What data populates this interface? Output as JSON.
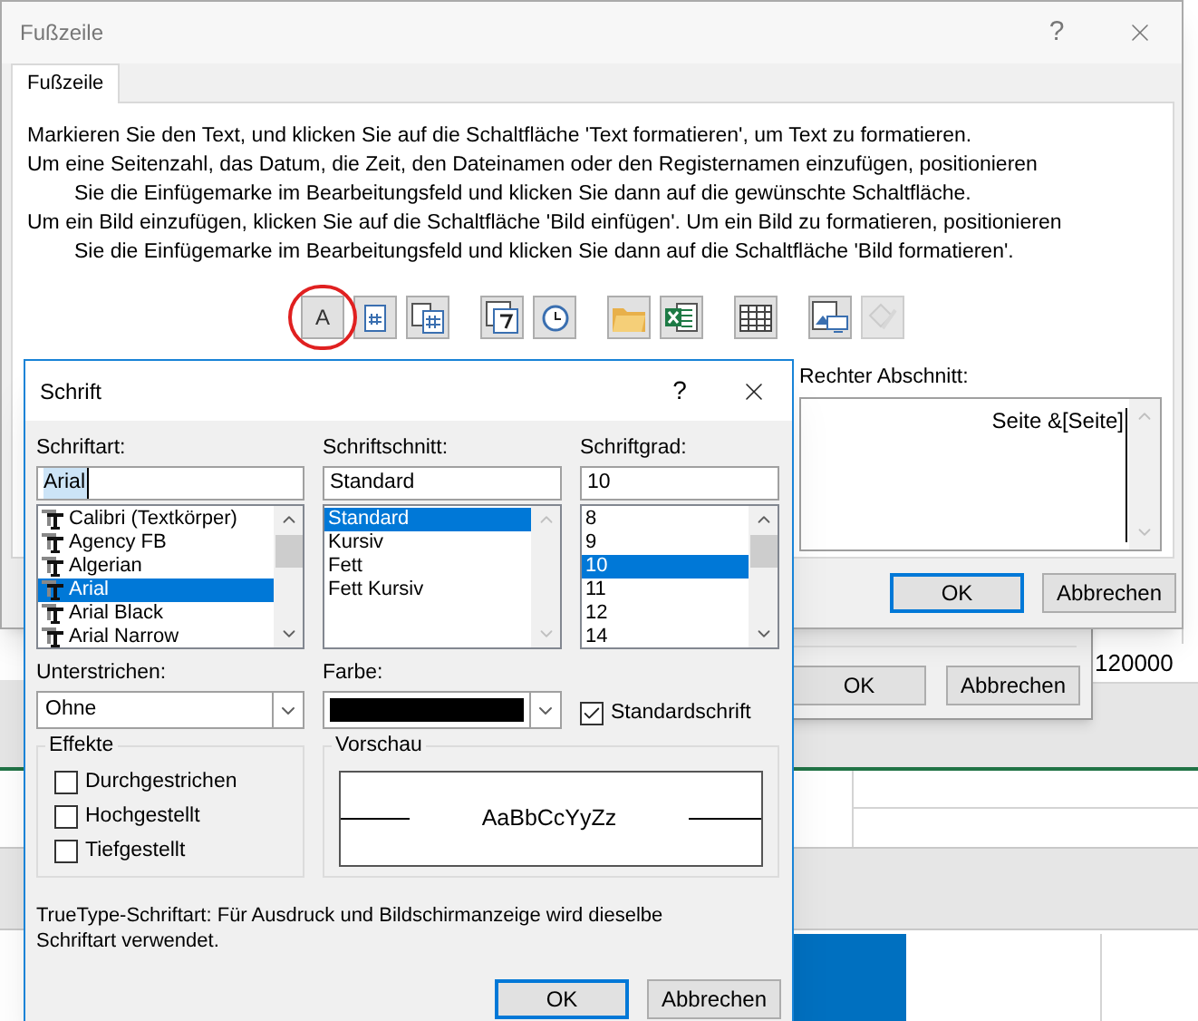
{
  "footer_dialog": {
    "title": "Fußzeile",
    "help": "?",
    "tab": {
      "label": "Fußzeile",
      "selected": true
    },
    "instructions": [
      {
        "text": "Markieren Sie den Text, und klicken Sie auf die Schaltfläche 'Text formatieren', um Text zu formatieren.",
        "indented": false
      },
      {
        "text": "Um eine Seitenzahl, das Datum, die Zeit, den Dateinamen oder den Registernamen einzufügen, positionieren",
        "indented": false
      },
      {
        "text": "Sie die Einfügemarke im Bearbeitungsfeld und klicken Sie dann auf die gewünschte Schaltfläche.",
        "indented": true
      },
      {
        "text": "Um ein Bild einzufügen, klicken Sie auf die Schaltfläche 'Bild einfügen'. Um ein Bild zu formatieren, positionieren",
        "indented": false
      },
      {
        "text": "Sie die Einfügemarke im Bearbeitungsfeld und klicken Sie dann auf die Schaltfläche 'Bild formatieren'.",
        "indented": true
      }
    ],
    "toolbar": [
      {
        "kind": "text",
        "label": "A",
        "circled": true,
        "disabled": false
      },
      {
        "kind": "page-number",
        "circled": false,
        "disabled": false
      },
      {
        "kind": "page-count",
        "circled": false,
        "disabled": false
      },
      {
        "kind": "date",
        "circled": false,
        "disabled": false
      },
      {
        "kind": "time",
        "circled": false,
        "disabled": false
      },
      {
        "kind": "path",
        "circled": false,
        "disabled": false
      },
      {
        "kind": "file",
        "circled": false,
        "disabled": false
      },
      {
        "kind": "sheet",
        "circled": false,
        "disabled": false
      },
      {
        "kind": "picture",
        "circled": false,
        "disabled": false
      },
      {
        "kind": "format-picture",
        "circled": false,
        "disabled": true
      }
    ],
    "right_section": {
      "label": "Rechter Abschnitt:",
      "value": "Seite &[Seite]"
    },
    "buttons": [
      {
        "label": "OK",
        "default": true
      },
      {
        "label": "Abbrechen",
        "default": false
      }
    ]
  },
  "back_dialog": {
    "buttons": [
      {
        "label": "OK",
        "default": false
      },
      {
        "label": "Abbrechen",
        "default": false
      }
    ]
  },
  "sheet": {
    "cells": [
      "120000"
    ]
  },
  "font_dialog": {
    "title": "Schrift",
    "help": "?",
    "font": {
      "label": "Schriftart:",
      "value": "Arial",
      "items": [
        {
          "label": "Calibri (Textkörper)",
          "selected": false
        },
        {
          "label": "Agency FB",
          "selected": false
        },
        {
          "label": "Algerian",
          "selected": false
        },
        {
          "label": "Arial",
          "selected": true
        },
        {
          "label": "Arial Black",
          "selected": false
        },
        {
          "label": "Arial Narrow",
          "selected": false
        }
      ]
    },
    "style": {
      "label": "Schriftschnitt:",
      "value": "Standard",
      "items": [
        {
          "label": "Standard",
          "selected": true
        },
        {
          "label": "Kursiv",
          "selected": false
        },
        {
          "label": "Fett",
          "selected": false
        },
        {
          "label": "Fett Kursiv",
          "selected": false
        }
      ]
    },
    "size": {
      "label": "Schriftgrad:",
      "value": "10",
      "items": [
        {
          "label": "8",
          "selected": false
        },
        {
          "label": "9",
          "selected": false
        },
        {
          "label": "10",
          "selected": true
        },
        {
          "label": "11",
          "selected": false
        },
        {
          "label": "12",
          "selected": false
        },
        {
          "label": "14",
          "selected": false
        }
      ]
    },
    "underline": {
      "label": "Unterstrichen:",
      "value": "Ohne"
    },
    "color": {
      "label": "Farbe:",
      "color": "#000000"
    },
    "standard_font": {
      "label": "Standardschrift",
      "checked": true
    },
    "effects": {
      "title": "Effekte",
      "items": [
        {
          "label": "Durchgestrichen",
          "checked": false
        },
        {
          "label": "Hochgestellt",
          "checked": false
        },
        {
          "label": "Tiefgestellt",
          "checked": false
        }
      ]
    },
    "preview": {
      "title": "Vorschau",
      "sample": "AaBbCcYyZz"
    },
    "note": "TrueType-Schriftart: Für Ausdruck und Bildschirmanzeige wird dieselbe Schriftart verwendet.",
    "buttons": [
      {
        "label": "OK",
        "default": true
      },
      {
        "label": "Abbrechen",
        "default": false
      }
    ]
  }
}
